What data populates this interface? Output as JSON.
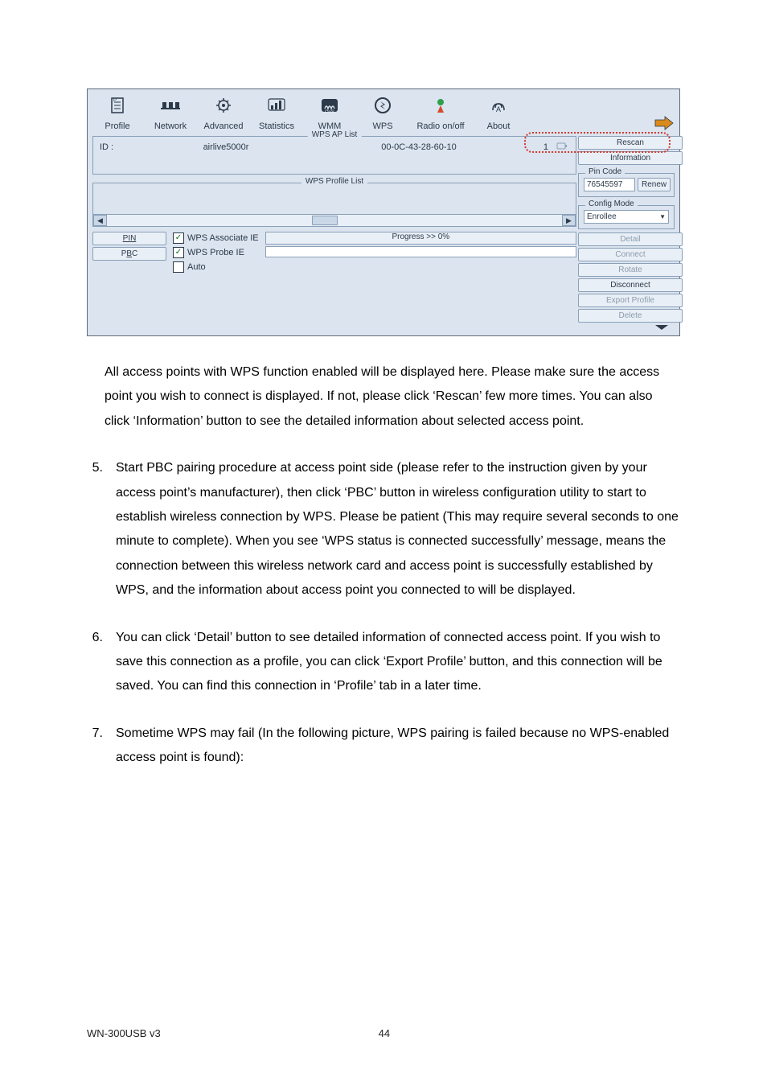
{
  "toolbar": {
    "items": [
      {
        "name": "profile-tab",
        "label": "Profile"
      },
      {
        "name": "network-tab",
        "label": "Network"
      },
      {
        "name": "advanced-tab",
        "label": "Advanced"
      },
      {
        "name": "statistics-tab",
        "label": "Statistics"
      },
      {
        "name": "wmm-tab",
        "label": "WMM"
      },
      {
        "name": "wps-tab",
        "label": "WPS"
      },
      {
        "name": "radio-tab",
        "label": "Radio on/off"
      },
      {
        "name": "about-tab",
        "label": "About"
      }
    ]
  },
  "wps_ap_list": {
    "title": "WPS AP List",
    "id_label": "ID :",
    "rows": [
      {
        "ssid": "airlive5000r",
        "mac": "00-0C-43-28-60-10",
        "channel": "1"
      }
    ]
  },
  "wps_profile_list": {
    "title": "WPS Profile List"
  },
  "right": {
    "rescan": "Rescan",
    "information": "Information",
    "pin_code": {
      "title": "Pin Code",
      "value": "76545597",
      "renew": "Renew"
    },
    "config_mode": {
      "title": "Config Mode",
      "value": "Enrollee"
    },
    "buttons": {
      "detail": "Detail",
      "connect": "Connect",
      "rotate": "Rotate",
      "disconnect": "Disconnect",
      "export_profile": "Export Profile",
      "delete": "Delete"
    }
  },
  "bottom": {
    "pin": "PIN",
    "pbc": "PBC",
    "assoc": "WPS Associate IE",
    "probe": "WPS Probe IE",
    "auto": "Auto",
    "progress": "Progress >> 0%"
  },
  "body": {
    "p1": "All access points with WPS function enabled will be displayed here. Please make sure the access point you wish to connect is displayed. If not, please click ‘Rescan’ few more times. You can also click ‘Information’ button to see the detailed information about selected access point.",
    "i5": {
      "n": "5.",
      "t": "Start PBC pairing procedure at access point side (please refer to the instruction given by your access point’s manufacturer), then click ‘PBC’ button in wireless configuration utility to start to establish wireless connection by WPS. Please be patient (This may require several seconds to one minute to complete). When you see ‘WPS status is connected successfully’ message, means the connection between this wireless network card and access point is successfully established by WPS, and the information about access point you connected to will be displayed."
    },
    "i6": {
      "n": "6.",
      "t": "You can click ‘Detail’ button to see detailed information of connected access point. If you wish to save this connection as a profile, you can click ‘Export Profile’ button, and this connection will be saved. You can find this connection in ‘Profile’ tab in a later time."
    },
    "i7": {
      "n": "7.",
      "t": "Sometime WPS may fail (In the following picture, WPS pairing is failed because no WPS-enabled access point is found):"
    }
  },
  "footer": {
    "model": "WN-300USB v3",
    "page": "44"
  }
}
